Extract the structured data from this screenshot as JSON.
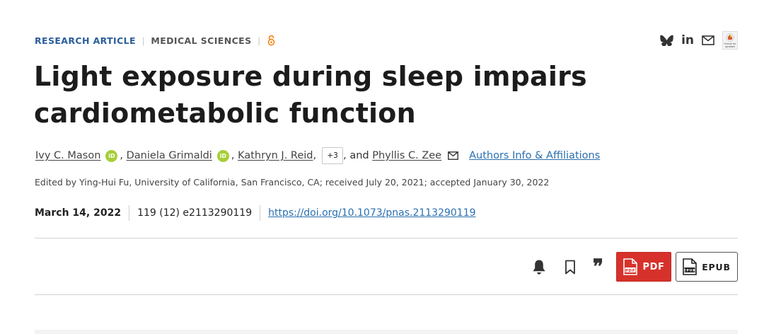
{
  "header": {
    "category_primary": "RESEARCH ARTICLE",
    "category_secondary": "MEDICAL SCIENCES",
    "separator": "|",
    "open_access_icon": "open-access-icon",
    "share_icons": [
      "bluesky-icon",
      "linkedin-icon",
      "email-icon"
    ],
    "linkedin_label": "in",
    "crossmark_label": "Check for updates",
    "colors": {
      "accent": "#2a5d9c",
      "link": "#2a6fb0",
      "open_access": "#f68212",
      "pdf_red": "#d6322b",
      "orcid_green": "#a6ce39"
    }
  },
  "article": {
    "title_line1": "Light exposure during sleep impairs",
    "title_line2": "cardiometabolic function",
    "authors": [
      {
        "name": "Ivy C. Mason",
        "orcid": true
      },
      {
        "name": "Daniela Grimaldi",
        "orcid": true
      },
      {
        "name": "Kathryn J. Reid",
        "orcid": false
      }
    ],
    "more_authors": "+3",
    "and_text": ", and",
    "comma": ",",
    "last_author": "Phyllis C. Zee",
    "orcid_label": "iD",
    "affiliations_link": "Authors Info & Affiliations",
    "edited_by": "Edited by Ying-Hui Fu, University of California, San Francisco, CA; received July 20, 2021; accepted January 30, 2022",
    "date": "March 14, 2022",
    "citation": "119 (12) e2113290119",
    "doi": "https://doi.org/10.1073/pnas.2113290119"
  },
  "toolbar": {
    "icons": [
      "bell-icon",
      "bookmark-icon",
      "cite-icon"
    ],
    "cite_glyph": "❞",
    "pdf_label": "PDF",
    "pdf_icon_text": "PDF",
    "epub_label": "EPUB",
    "epub_icon_text": "EPUB"
  }
}
